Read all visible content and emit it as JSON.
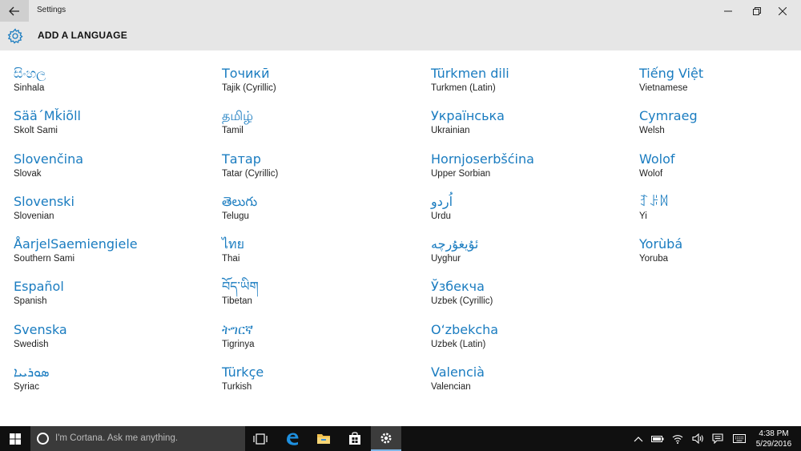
{
  "window": {
    "title": "Settings"
  },
  "header": {
    "heading": "ADD A LANGUAGE"
  },
  "languages": {
    "col0": [
      {
        "native": "සිංහල",
        "english": "Sinhala"
      },
      {
        "native": "Sää´Mǩiõll",
        "english": "Skolt Sami"
      },
      {
        "native": "Slovenčina",
        "english": "Slovak"
      },
      {
        "native": "Slovenski",
        "english": "Slovenian"
      },
      {
        "native": "ÅarjelSaemiengiele",
        "english": "Southern Sami"
      },
      {
        "native": "Español",
        "english": "Spanish"
      },
      {
        "native": "Svenska",
        "english": "Swedish"
      },
      {
        "native": "ܣܘܪܝܝܐ",
        "english": "Syriac"
      }
    ],
    "col1": [
      {
        "native": "Точикӣ",
        "english": "Tajik (Cyrillic)"
      },
      {
        "native": "தமிழ்",
        "english": "Tamil"
      },
      {
        "native": "Татар",
        "english": "Tatar (Cyrillic)"
      },
      {
        "native": "తెలుగు",
        "english": "Telugu"
      },
      {
        "native": "ไทย",
        "english": "Thai"
      },
      {
        "native": "བོད་ཡིག",
        "english": "Tibetan"
      },
      {
        "native": "ትግርኛ",
        "english": "Tigrinya"
      },
      {
        "native": "Türkçe",
        "english": "Turkish"
      }
    ],
    "col2": [
      {
        "native": "Türkmen dili",
        "english": "Turkmen (Latin)"
      },
      {
        "native": "Українська",
        "english": "Ukrainian"
      },
      {
        "native": "Hornjoserbšćina",
        "english": "Upper Sorbian"
      },
      {
        "native": "اُردو",
        "english": "Urdu"
      },
      {
        "native": "ئۇيغۇرچە",
        "english": "Uyghur"
      },
      {
        "native": "Ўзбекча",
        "english": "Uzbek (Cyrillic)"
      },
      {
        "native": "O‘zbekcha",
        "english": "Uzbek (Latin)"
      },
      {
        "native": "Valencià",
        "english": "Valencian"
      }
    ],
    "col3": [
      {
        "native": "Tiếng Việt",
        "english": "Vietnamese"
      },
      {
        "native": "Cymraeg",
        "english": "Welsh"
      },
      {
        "native": "Wolof",
        "english": "Wolof"
      },
      {
        "native": "ꆈꌠꉙ",
        "english": "Yi"
      },
      {
        "native": "Yorùbá",
        "english": "Yoruba"
      }
    ]
  },
  "taskbar": {
    "search_placeholder": "I'm Cortana. Ask me anything.",
    "time": "4:38 PM",
    "date": "5/29/2016"
  },
  "colors": {
    "accent": "#1a7cc0",
    "titlebar": "#e6e6e6",
    "taskbar": "#101010"
  }
}
